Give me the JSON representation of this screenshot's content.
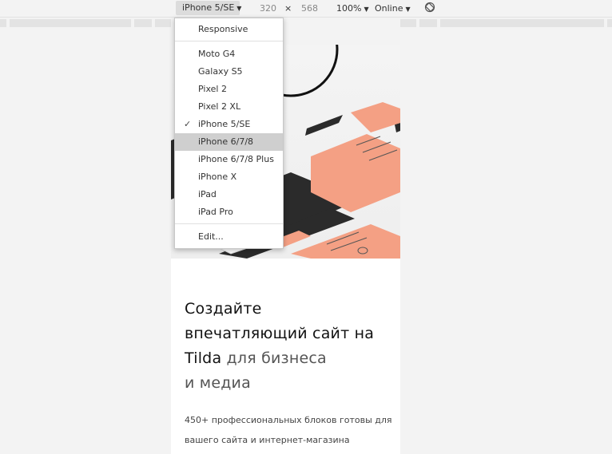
{
  "toolbar": {
    "device_label": "iPhone 5/SE",
    "width": "320",
    "times": "×",
    "height": "568",
    "zoom": "100%",
    "throttle": "Online"
  },
  "menu": {
    "items": [
      {
        "label": "Responsive"
      },
      {
        "label": "Moto G4"
      },
      {
        "label": "Galaxy S5"
      },
      {
        "label": "Pixel 2"
      },
      {
        "label": "Pixel 2 XL"
      },
      {
        "label": "iPhone 5/SE",
        "checked": true
      },
      {
        "label": "iPhone 6/7/8",
        "highlighted": true
      },
      {
        "label": "iPhone 6/7/8 Plus"
      },
      {
        "label": "iPhone X"
      },
      {
        "label": "iPad"
      },
      {
        "label": "iPad Pro"
      },
      {
        "label": "Edit..."
      }
    ]
  },
  "page": {
    "headline_line1": "Создайте",
    "headline_line2": "впечатляющий сайт на",
    "headline_brand": "Tilda",
    "headline_tail": " для бизнеса",
    "headline_line4": "и медиа",
    "subtext_line1": "450+ профессиональных блоков готовы для",
    "subtext_line2": "вашего сайта и интернет-магазина"
  },
  "colors": {
    "accent_salmon": "#f4a084",
    "dark_card": "#2b2b2b",
    "highlight": "#cfcfcf"
  }
}
